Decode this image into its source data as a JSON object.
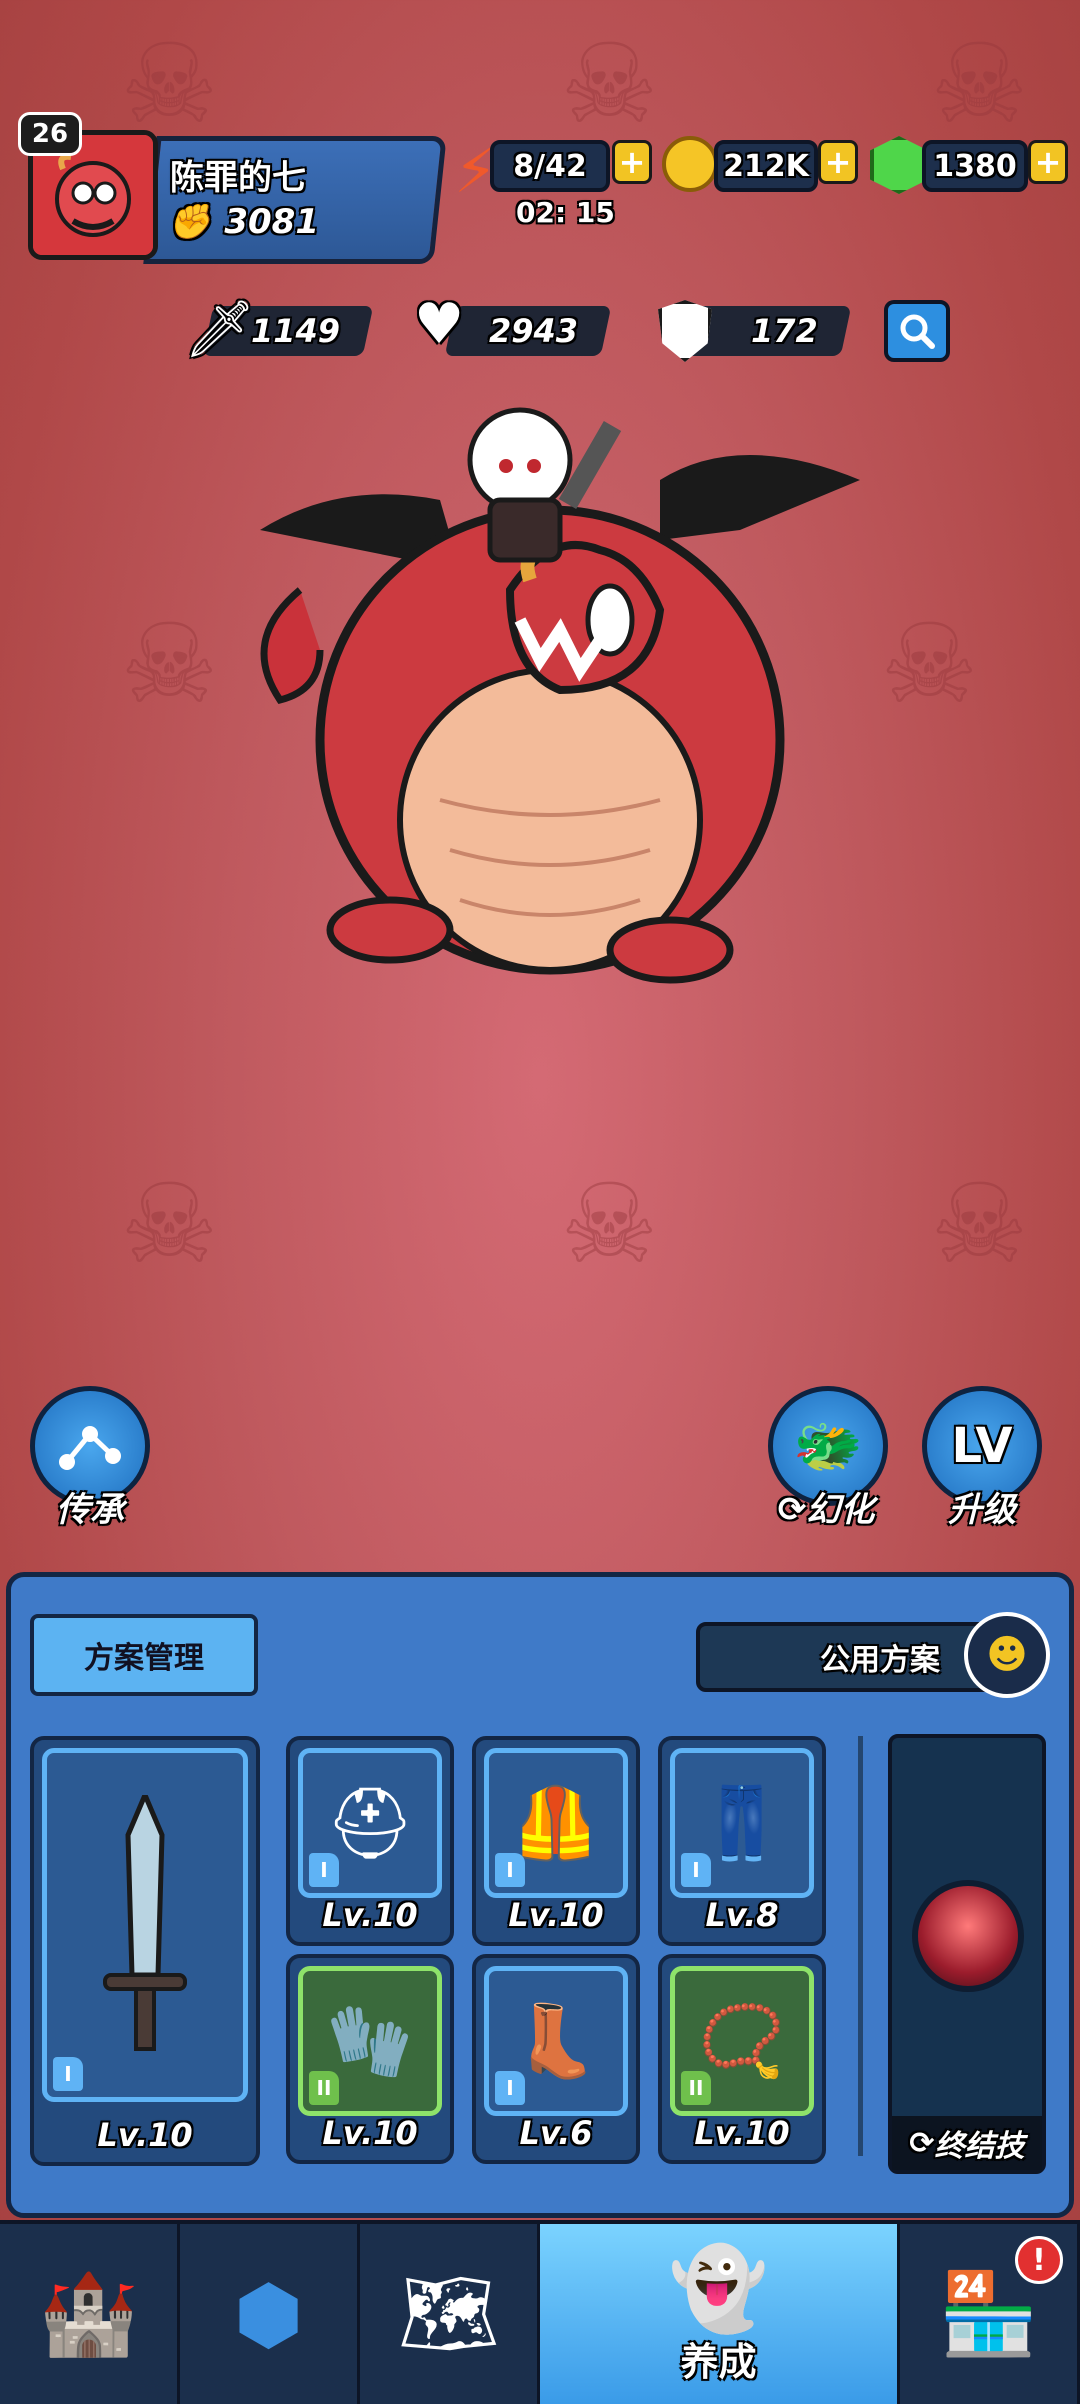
{
  "player": {
    "level": "26",
    "name": "陈罪的七",
    "power": "3081"
  },
  "resources": {
    "stamina": "8/42",
    "stamina_timer": "02: 15",
    "gold": "212K",
    "gems": "1380",
    "plus": "+"
  },
  "stats": {
    "attack": "1149",
    "health": "2943",
    "defense": "172"
  },
  "actions": {
    "inherit": "传承",
    "transform": "幻化",
    "upgrade": "升级",
    "upgrade_icon_text": "LV"
  },
  "panel": {
    "scheme_manage": "方案管理",
    "public_scheme": "公用方案",
    "weapon_level": "Lv.10",
    "weapon_rank": "I",
    "equipment": [
      {
        "name": "helmet",
        "level": "Lv.10",
        "rank": "I",
        "quality": "blue"
      },
      {
        "name": "armor",
        "level": "Lv.10",
        "rank": "I",
        "quality": "blue"
      },
      {
        "name": "pants",
        "level": "Lv.8",
        "rank": "I",
        "quality": "blue"
      },
      {
        "name": "bracer",
        "level": "Lv.10",
        "rank": "II",
        "quality": "green"
      },
      {
        "name": "boots",
        "level": "Lv.6",
        "rank": "I",
        "quality": "blue"
      },
      {
        "name": "necklace",
        "level": "Lv.10",
        "rank": "II",
        "quality": "green"
      }
    ],
    "finisher_label": "终结技"
  },
  "nav": {
    "active_label": "养成",
    "notification": "!"
  },
  "colors": {
    "accent_blue": "#3f7ac8",
    "gold": "#f2c423",
    "background": "#c05a5f"
  }
}
